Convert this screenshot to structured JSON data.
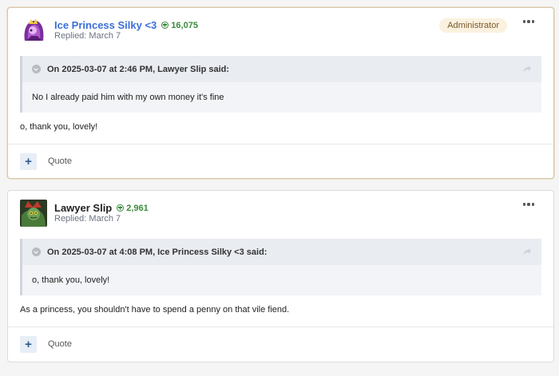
{
  "posts": [
    {
      "author": "Ice Princess Silky <3",
      "reputation": "16,075",
      "replied": "Replied: March 7",
      "badge": "Administrator",
      "quote_header": "On 2025-03-07 at 2:46 PM, Lawyer Slip said:",
      "quote_body": "No I already paid him with my own money it's fine",
      "text": "o, thank you, lovely!",
      "quote_action": "Quote",
      "plus_label": "+"
    },
    {
      "author": "Lawyer Slip",
      "reputation": "2,961",
      "replied": "Replied: March 7",
      "quote_header": "On 2025-03-07 at 4:08 PM, Ice Princess Silky <3 said:",
      "quote_body": "o, thank you, lovely!",
      "text": "As a princess, you shouldn't have to spend a penny on that vile fiend.",
      "quote_action": "Quote",
      "plus_label": "+"
    }
  ],
  "icons": [
    "reputation-icon",
    "more-options-icon",
    "collapse-chevron-icon",
    "share-quote-icon",
    "plus-icon"
  ],
  "colors": {
    "admin_name": "#3a6fd8",
    "reputation": "#3a8a3a",
    "badge_bg": "#fbf1df"
  }
}
